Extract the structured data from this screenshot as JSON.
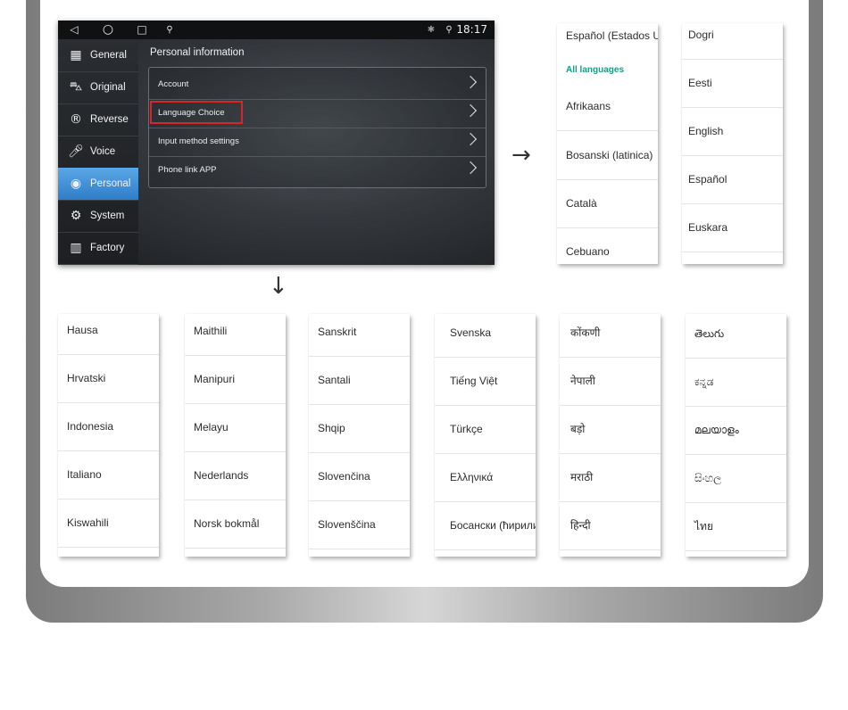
{
  "statusbar": {
    "back": "◁",
    "home": "○",
    "recents": "□",
    "usb": "⚲",
    "bluetooth": "✱",
    "location": "⚲",
    "time": "18:17"
  },
  "sidebar": {
    "items": [
      {
        "label": "General",
        "icon": "general-icon",
        "glyph": "▦"
      },
      {
        "label": "Original",
        "icon": "car-icon",
        "glyph": "⛍"
      },
      {
        "label": "Reverse",
        "icon": "reverse-icon",
        "glyph": "®"
      },
      {
        "label": "Voice",
        "icon": "microphone-icon",
        "glyph": "🎤︎"
      },
      {
        "label": "Personal",
        "icon": "person-icon",
        "glyph": "◉"
      },
      {
        "label": "System",
        "icon": "gear-icon",
        "glyph": "⚙"
      },
      {
        "label": "Factory",
        "icon": "factory-icon",
        "glyph": "▥"
      }
    ],
    "active": "Personal",
    "active_color": "#3f8fd6"
  },
  "content": {
    "title": "Personal information",
    "menu": [
      {
        "label": "Account"
      },
      {
        "label": "Language Choice"
      },
      {
        "label": "Input method settings"
      },
      {
        "label": "Phone link APP"
      }
    ],
    "highlight_color": "#d7262b"
  },
  "arrows": {
    "right": "→",
    "down": "↓"
  },
  "lists": {
    "accent_color": "#1a9a86",
    "top_left": {
      "header_top": "Español (Estados Unidos)",
      "section": "All languages",
      "items": [
        "Afrikaans",
        "Bosanski (latinica)",
        "Català",
        "Cebuano"
      ]
    },
    "top_right": {
      "items": [
        "Dogri",
        "Eesti",
        "English",
        "Español",
        "Euskara"
      ]
    },
    "bottom": [
      {
        "items": [
          "Hausa",
          "Hrvatski",
          "Indonesia",
          "Italiano",
          "Kiswahili"
        ]
      },
      {
        "items": [
          "Maithili",
          "Manipuri",
          "Melayu",
          "Nederlands",
          "Norsk bokmål"
        ]
      },
      {
        "items": [
          "Sanskrit",
          "Santali",
          "Shqip",
          "Slovenčina",
          "Slovenščina"
        ]
      },
      {
        "items": [
          "Svenska",
          "Tiếng Việt",
          "Türkçe",
          "Ελληνικά",
          "Босански (ћирилица)"
        ]
      },
      {
        "items": [
          "कोंकणी",
          "नेपाली",
          "बड़ो",
          "मराठी",
          "हिन्दी"
        ]
      },
      {
        "items": [
          "తెలుగు",
          "ಕನ್ನಡ",
          "മലയാളം",
          "සිංහල",
          "ไทย"
        ]
      }
    ]
  }
}
